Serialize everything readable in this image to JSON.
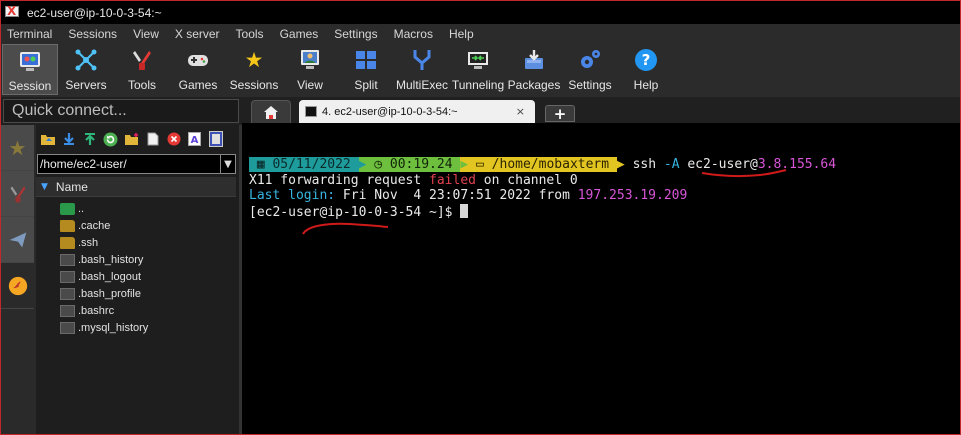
{
  "window": {
    "title": "ec2-user@ip-10-0-3-54:~"
  },
  "menu": [
    "Terminal",
    "Sessions",
    "View",
    "X server",
    "Tools",
    "Games",
    "Settings",
    "Macros",
    "Help"
  ],
  "toolbar": [
    {
      "label": "Session",
      "icon": "session-icon"
    },
    {
      "label": "Servers",
      "icon": "servers-icon"
    },
    {
      "label": "Tools",
      "icon": "tools-icon"
    },
    {
      "label": "Games",
      "icon": "gamepad-icon"
    },
    {
      "label": "Sessions",
      "icon": "star-icon"
    },
    {
      "label": "View",
      "icon": "view-icon"
    },
    {
      "label": "Split",
      "icon": "split-icon"
    },
    {
      "label": "MultiExec",
      "icon": "multiexec-icon"
    },
    {
      "label": "Tunneling",
      "icon": "tunneling-icon"
    },
    {
      "label": "Packages",
      "icon": "packages-icon"
    },
    {
      "label": "Settings",
      "icon": "gears-icon"
    },
    {
      "label": "Help",
      "icon": "help-icon"
    }
  ],
  "quick_connect": {
    "placeholder": "Quick connect..."
  },
  "tabs": {
    "active_label": "4. ec2-user@ip-10-0-3-54:~",
    "close": "×",
    "new": "+"
  },
  "file_browser": {
    "path": "/home/ec2-user/",
    "column": "Name",
    "items": [
      {
        "name": "..",
        "type": "up"
      },
      {
        "name": ".cache",
        "type": "folder"
      },
      {
        "name": ".ssh",
        "type": "folder"
      },
      {
        "name": ".bash_history",
        "type": "file"
      },
      {
        "name": ".bash_logout",
        "type": "file"
      },
      {
        "name": ".bash_profile",
        "type": "file"
      },
      {
        "name": ".bashrc",
        "type": "file"
      },
      {
        "name": ".mysql_history",
        "type": "file"
      }
    ]
  },
  "terminal": {
    "prompt": {
      "date": "05/11/2022",
      "time": "00:19.24",
      "path": "/home/mobaxterm",
      "command": "ssh",
      "flag": "-A",
      "user": "ec2-user",
      "at": "@",
      "host_ip": "3.8.155.64"
    },
    "x11": {
      "pre": "X11 forwarding request ",
      "failed": "failed",
      "post": " on channel 0"
    },
    "last_login": {
      "label": "Last login:",
      "when": " Fri Nov  4 23:07:51 2022 from ",
      "ip": "197.253.19.209"
    },
    "shell_prompt": "[ec2-user@ip-10-0-3-54 ~]$ "
  },
  "colors": {
    "accent_red": "#c0282d",
    "annotation": "#d01a1a"
  }
}
